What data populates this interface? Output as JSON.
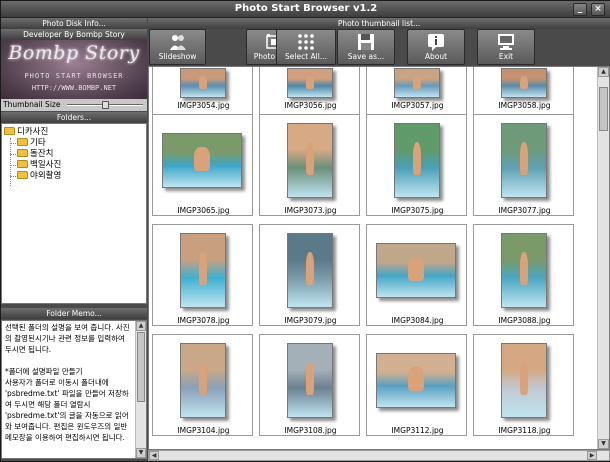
{
  "window": {
    "title": "Photo Start Browser v1.2"
  },
  "left": {
    "disk_header": "Photo Disk Info...",
    "dev_header": "Developer By Bombp Story",
    "logo": {
      "brand": "Bombp Story",
      "sub": "PHOTO START BROWSER",
      "url": "HTTP://WWW.BOMBP.NET"
    },
    "thumbnail_size": {
      "label": "Thumbnail Size",
      "level": 0.48
    },
    "folders_header": "Folders...",
    "folders": {
      "root": "디카사진",
      "children": [
        "기타",
        "돌잔치",
        "백일사진",
        "야외촬영"
      ]
    },
    "memo_header": "Folder Memo...",
    "memo_text": "선택된 폴더의 설명을 보여 줍니다. 사진의 촬영된시기나 관련 정보를 입력하여 두시면 됩니다.\n\n*폴더에 설명파일 만들기\n사용자가 폴더로 이동시 폴더내에 'psbredme.txt' 파일을 만들어 저장하여 두시면 해당 폴더 열람시 'psbredme.txt'의 글을 자동으로 읽어와 보여줍니다. 편집은 윈도우즈의 일반 메모장을 이용하여 편집하시면 됩니다."
  },
  "right": {
    "list_header": "Photo thumbnail list...",
    "toolbar": [
      {
        "label": "Slideshow",
        "icon": "people-icon"
      },
      {
        "label": "Photo View",
        "icon": "photo-view-icon"
      },
      {
        "label": "Select All...",
        "icon": "grid-icon"
      },
      {
        "label": "Save as...",
        "icon": "floppy-icon"
      },
      {
        "label": "About",
        "icon": "info-icon"
      },
      {
        "label": "Exit",
        "icon": "monitor-icon"
      }
    ],
    "thumbnails": [
      {
        "name": "IMGP3054.jpg"
      },
      {
        "name": "IMGP3056.jpg"
      },
      {
        "name": "IMGP3057.jpg"
      },
      {
        "name": "IMGP3058.jpg"
      },
      {
        "name": "IMGP3065.jpg"
      },
      {
        "name": "IMGP3073.jpg"
      },
      {
        "name": "IMGP3075.jpg"
      },
      {
        "name": "IMGP3077.jpg"
      },
      {
        "name": "IMGP3078.jpg"
      },
      {
        "name": "IMGP3079.jpg"
      },
      {
        "name": "IMGP3084.jpg"
      },
      {
        "name": "IMGP3088.jpg"
      },
      {
        "name": "IMGP3104.jpg"
      },
      {
        "name": "IMGP3108.jpg"
      },
      {
        "name": "IMGP3112.jpg"
      },
      {
        "name": "IMGP3118.jpg"
      }
    ]
  }
}
